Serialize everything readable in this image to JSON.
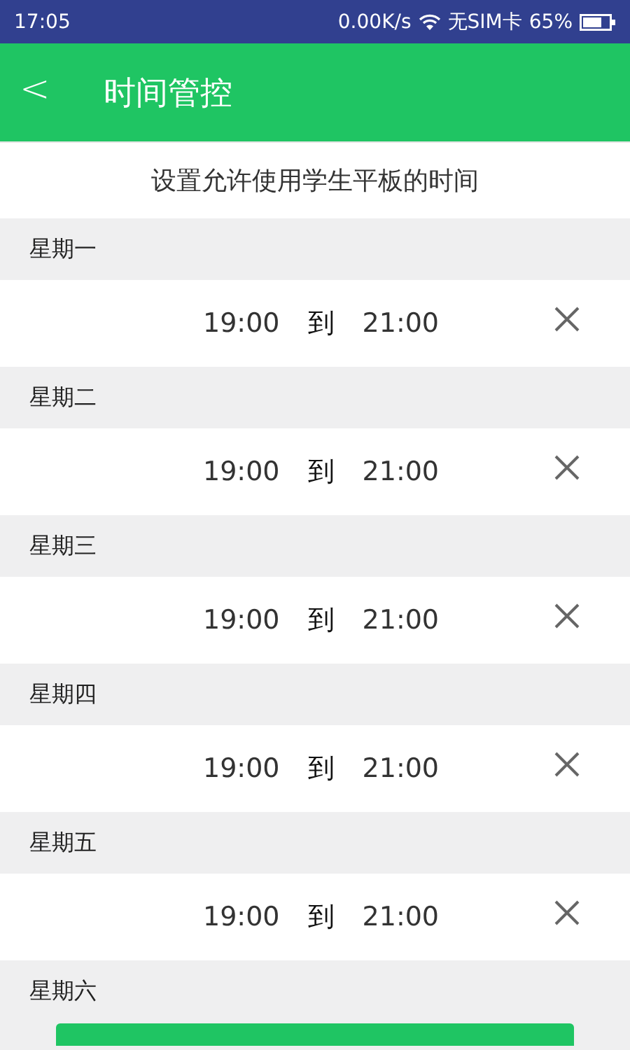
{
  "status_bar": {
    "time": "17:05",
    "speed": "0.00K/s",
    "sim": "无SIM卡",
    "battery": "65%"
  },
  "header": {
    "back": "<",
    "title": "时间管控"
  },
  "subtitle": "设置允许使用学生平板的时间",
  "days": [
    {
      "name": "星期一",
      "slots": [
        {
          "start": "19:00",
          "sep": "到",
          "end": "21:00"
        }
      ]
    },
    {
      "name": "星期二",
      "slots": [
        {
          "start": "19:00",
          "sep": "到",
          "end": "21:00"
        }
      ]
    },
    {
      "name": "星期三",
      "slots": [
        {
          "start": "19:00",
          "sep": "到",
          "end": "21:00"
        }
      ]
    },
    {
      "name": "星期四",
      "slots": [
        {
          "start": "19:00",
          "sep": "到",
          "end": "21:00"
        }
      ]
    },
    {
      "name": "星期五",
      "slots": [
        {
          "start": "19:00",
          "sep": "到",
          "end": "21:00"
        }
      ]
    },
    {
      "name": "星期六"
    }
  ],
  "bottom_button": {
    "kind": "button"
  }
}
